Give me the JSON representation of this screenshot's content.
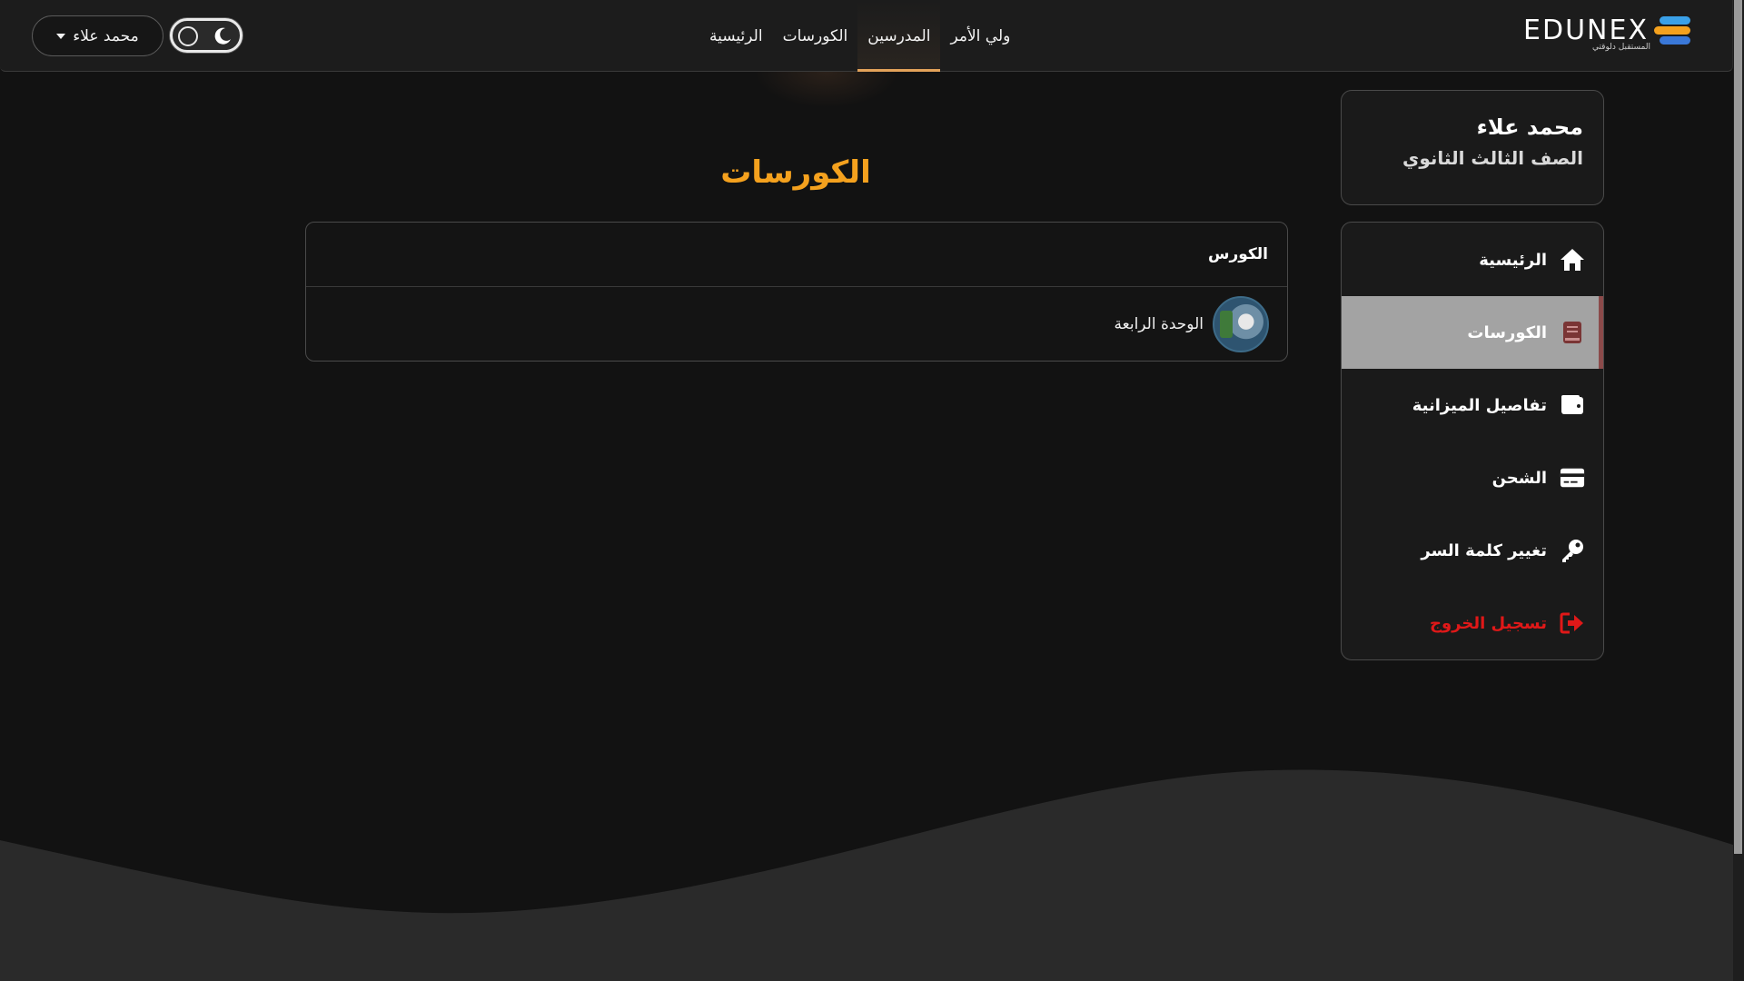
{
  "brand": {
    "logo_text": "EDUNEX",
    "logo_sub": "المستقبل دلوقتي",
    "colors": {
      "accent": "#f4a11e",
      "nav_active_underline": "#e3a25a",
      "logout": "#e01818"
    }
  },
  "nav": {
    "links": [
      {
        "label": "الرئيسية",
        "active": false
      },
      {
        "label": "الكورسات",
        "active": false
      },
      {
        "label": "المدرسين",
        "active": true
      },
      {
        "label": "ولي الأمر",
        "active": false
      }
    ],
    "user_button": "محمد علاء",
    "theme_toggle": {
      "icons": [
        "circle-icon",
        "moon-icon"
      ],
      "mode": "dark"
    }
  },
  "profile": {
    "name": "محمد علاء",
    "grade": "الصف الثالث الثانوي"
  },
  "sidebar": {
    "items": [
      {
        "label": "الرئيسية",
        "icon": "home-icon",
        "active": false
      },
      {
        "label": "الكورسات",
        "icon": "book-icon",
        "active": true
      },
      {
        "label": "تفاصيل الميزانية",
        "icon": "wallet-icon",
        "active": false
      },
      {
        "label": "الشحن",
        "icon": "credit-card-icon",
        "active": false
      },
      {
        "label": "تغيير كلمة السر",
        "icon": "key-icon",
        "active": false
      },
      {
        "label": "تسجيل الخروج",
        "icon": "logout-icon",
        "active": false
      }
    ]
  },
  "main": {
    "title": "الكورسات",
    "table": {
      "header": "الكورس",
      "rows": [
        {
          "name": "الوحدة الرابعة",
          "thumb": "course-thumbnail"
        }
      ]
    }
  }
}
